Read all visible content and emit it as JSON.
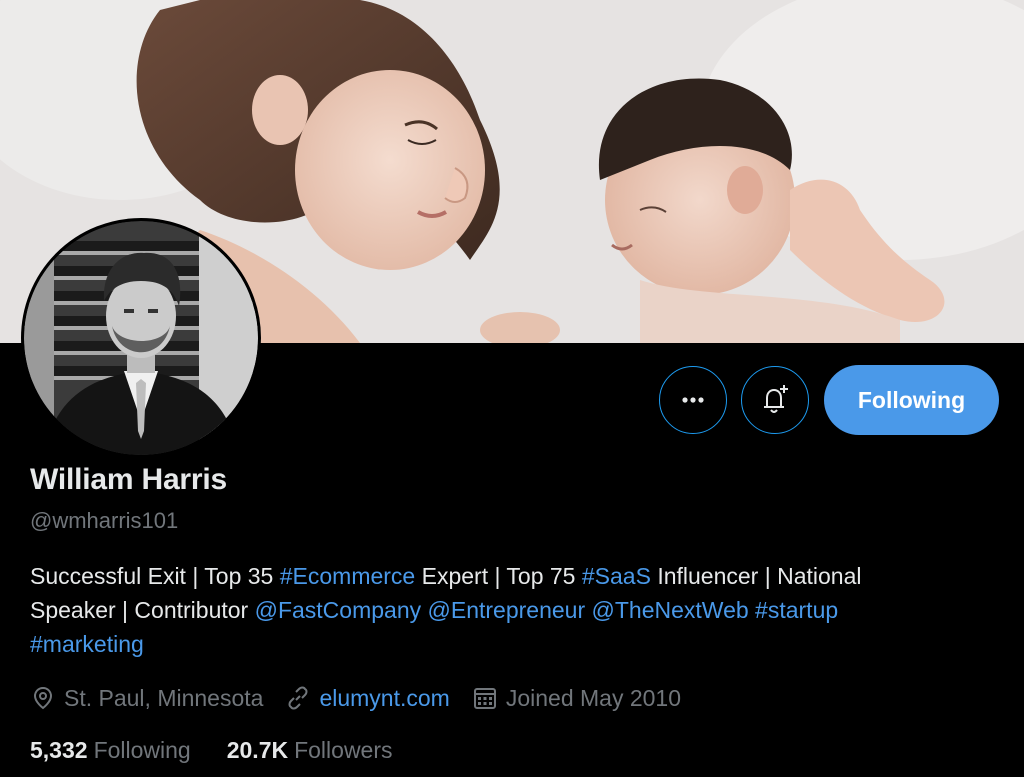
{
  "profile": {
    "name": "William Harris",
    "handle": "@wmharris101",
    "bio": {
      "line1": [
        "Successful Exit | Top 35 ",
        "#Ecommerce",
        " Expert | Top 75 ",
        "#SaaS",
        " Influencer | National"
      ],
      "line2": [
        "Speaker | Contributor ",
        "@FastCompany",
        " ",
        "@Entrepreneur",
        " ",
        "@TheNextWeb",
        " ",
        "#startup"
      ],
      "line3": [
        "#marketing"
      ]
    },
    "location": "St. Paul, Minnesota",
    "website": "elumynt.com",
    "joined": "Joined May 2010",
    "following_count": "5,332",
    "following_label": "Following",
    "followers_count": "20.7K",
    "followers_label": "Followers"
  },
  "actions": {
    "following_button": "Following"
  },
  "icons": {
    "more": "more-horizontal-icon",
    "notify": "bell-plus-icon",
    "location": "location-pin-icon",
    "website": "link-icon",
    "joined": "calendar-icon"
  },
  "colors": {
    "background": "#000000",
    "accent": "#4a99e9",
    "text_primary": "#e7e9ea",
    "text_secondary": "#71767b"
  }
}
